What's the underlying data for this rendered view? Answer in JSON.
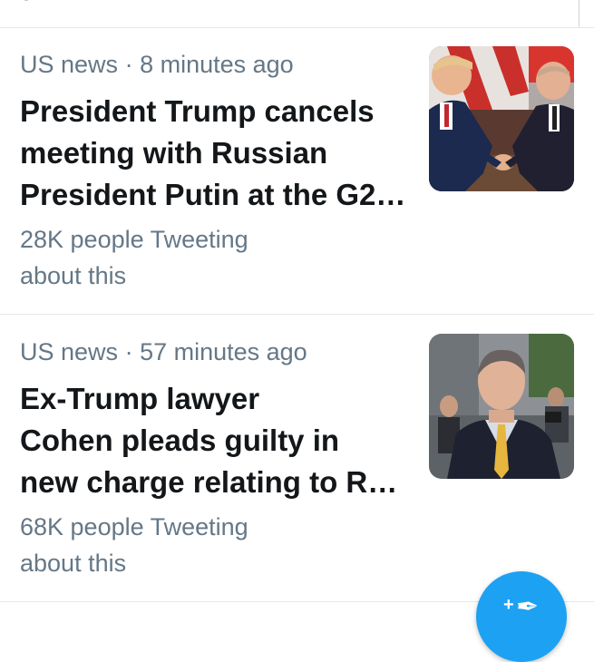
{
  "stories": [
    {
      "category": "US news",
      "separator": "·",
      "time": "8 minutes ago",
      "headline_lines": [
        "President Trump cancels",
        "meeting with Russian",
        "President Putin at the G2…"
      ],
      "tweet_count": "28K people Tweeting",
      "tweet_suffix": "about this",
      "thumbnail_icon": "photo-handshake"
    },
    {
      "category": "US news",
      "separator": "·",
      "time": "57 minutes ago",
      "headline_lines": [
        "Ex-Trump lawyer",
        "Cohen pleads guilty in",
        "new charge relating to R…"
      ],
      "tweet_count": "68K people Tweeting",
      "tweet_suffix": "about this",
      "thumbnail_icon": "photo-portrait"
    }
  ],
  "fab": {
    "icon": "compose-tweet-icon",
    "plus": "+",
    "color": "#1da1f2"
  },
  "colors": {
    "meta_text": "#657786",
    "headline_text": "#14171a",
    "divider": "#e1e8ed"
  }
}
